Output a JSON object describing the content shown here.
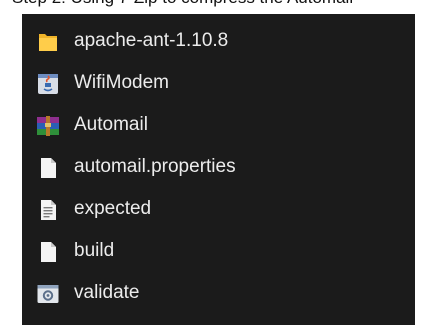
{
  "caption": "Step 2: Using 7-Zip to compress the Automail",
  "file_list": {
    "items": [
      {
        "name": "apache-ant-1.10.8",
        "icon": "folder-icon"
      },
      {
        "name": "WifiModem",
        "icon": "java-file-icon"
      },
      {
        "name": "Automail",
        "icon": "winrar-archive-icon"
      },
      {
        "name": "automail.properties",
        "icon": "blank-file-icon"
      },
      {
        "name": "expected",
        "icon": "text-file-icon"
      },
      {
        "name": "build",
        "icon": "blank-file-icon"
      },
      {
        "name": "validate",
        "icon": "settings-file-icon"
      }
    ]
  }
}
